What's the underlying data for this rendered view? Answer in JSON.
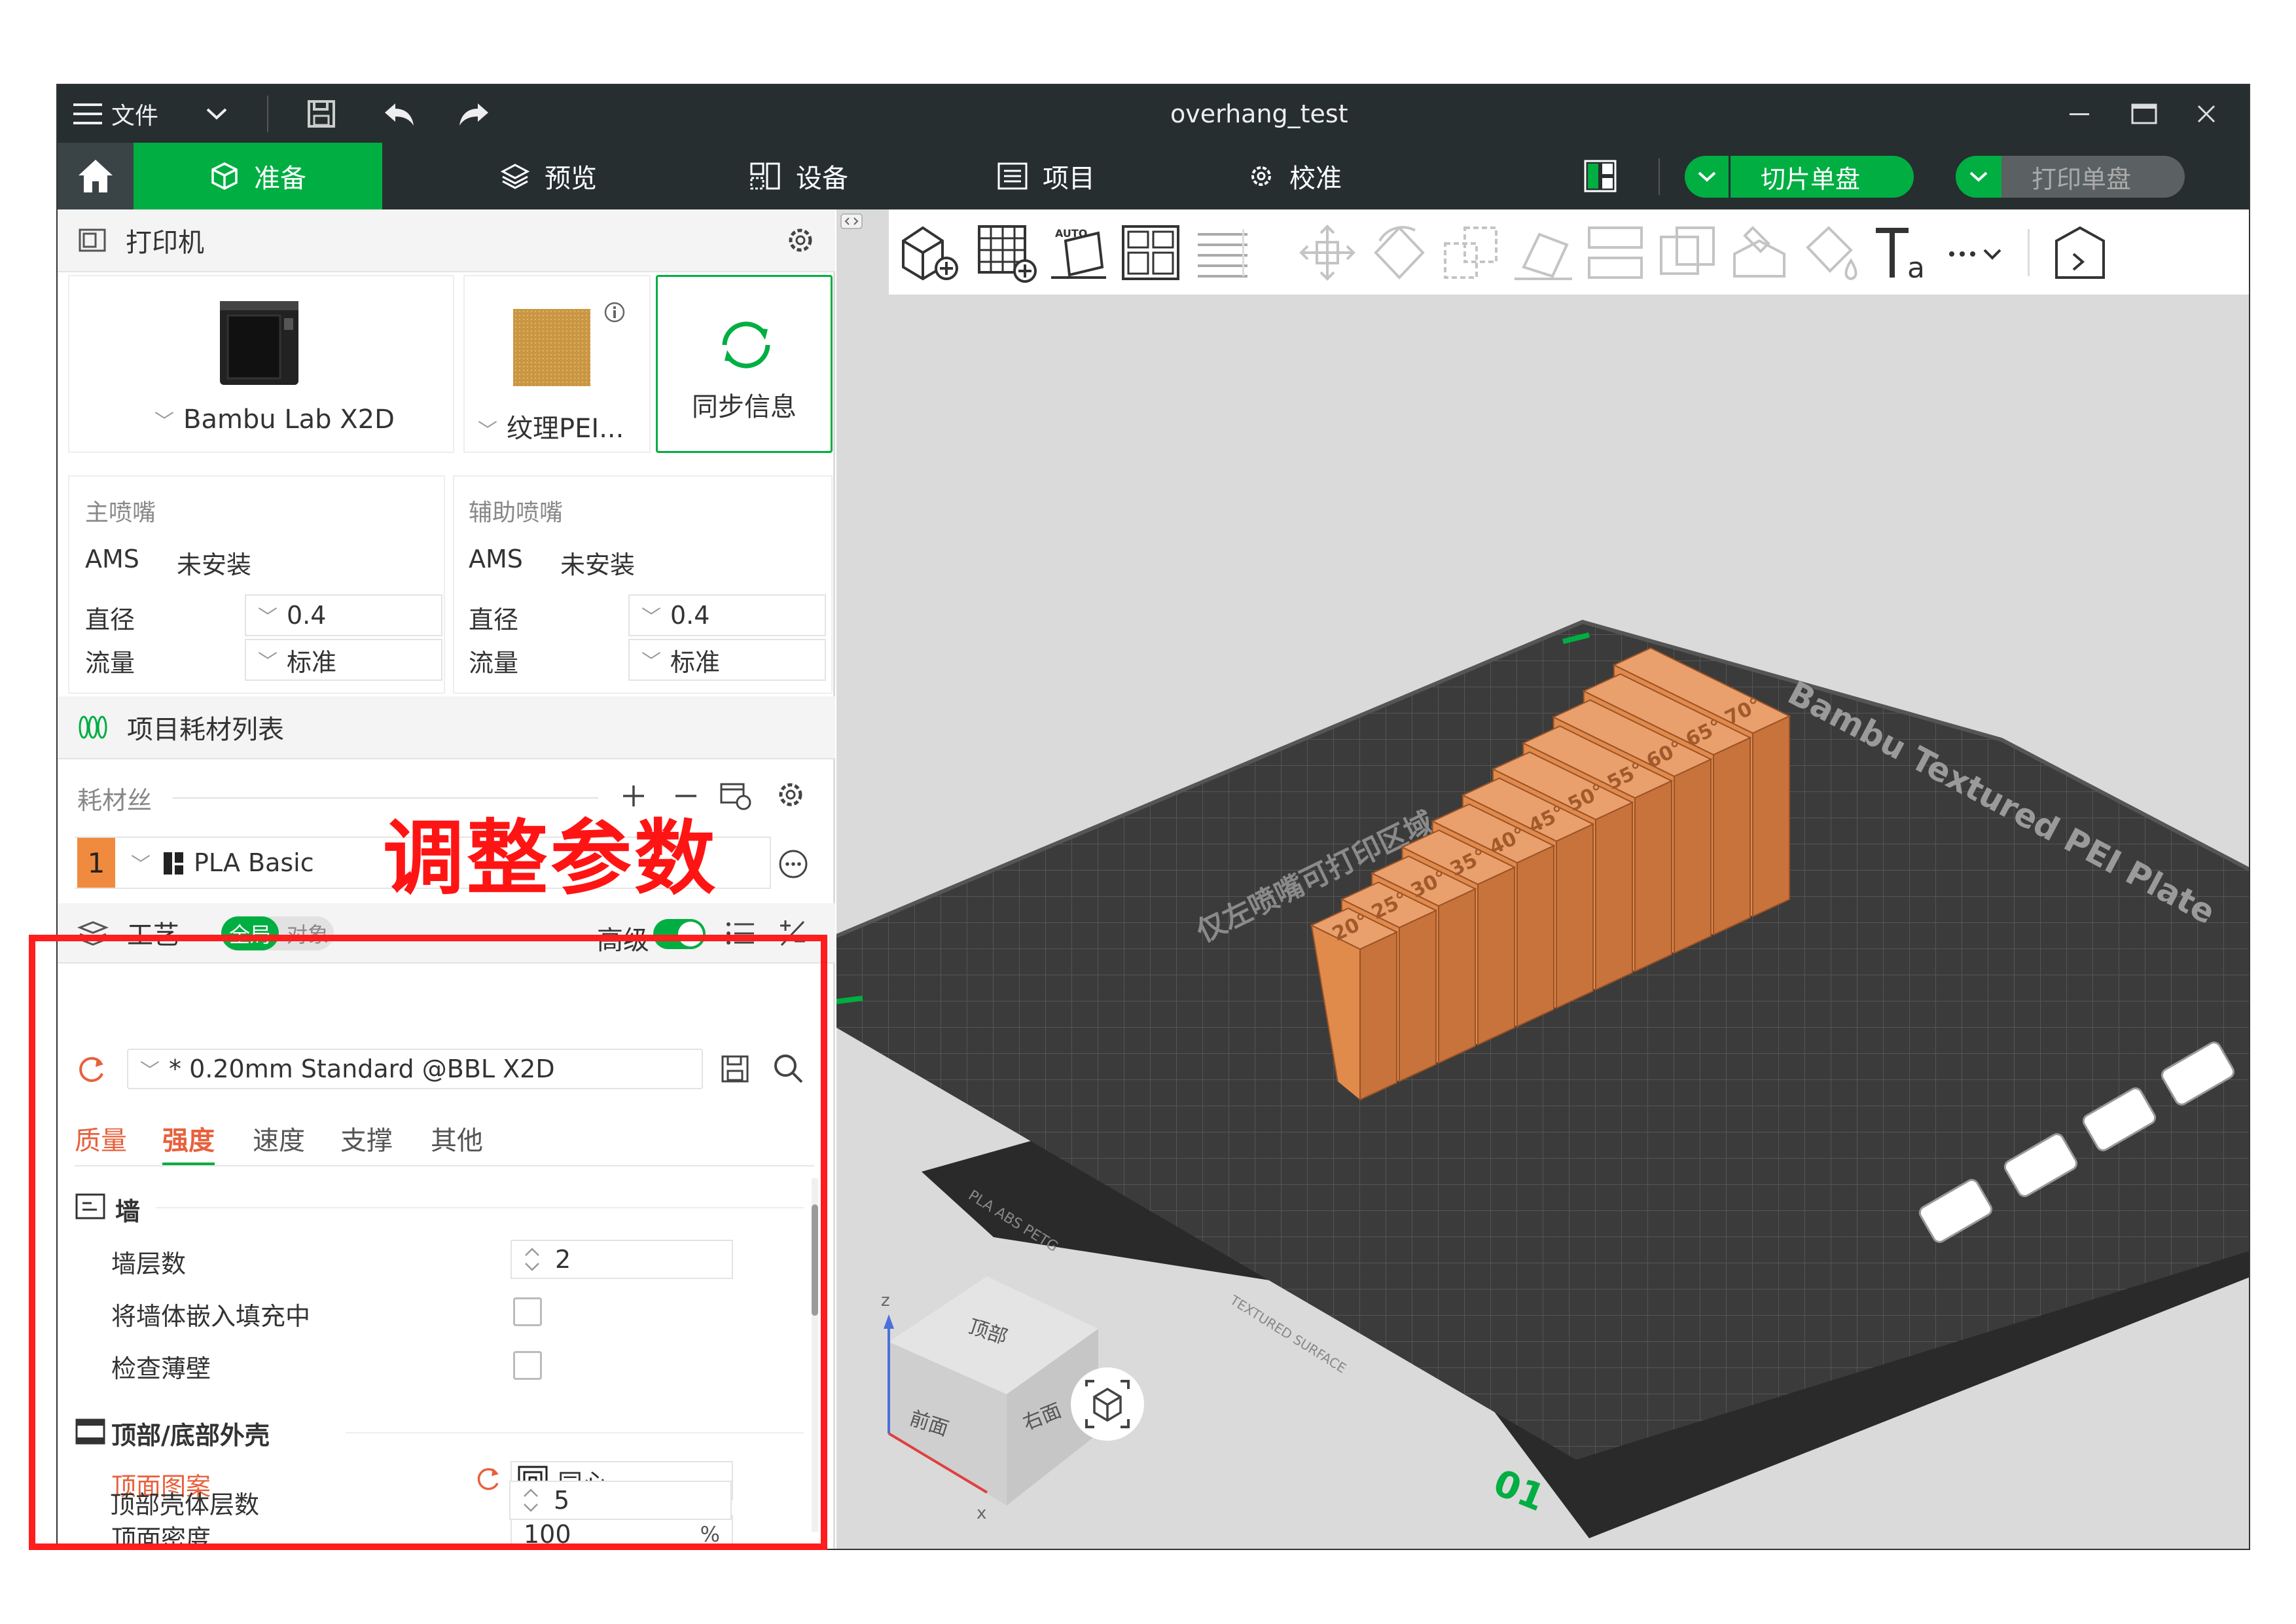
{
  "window": {
    "file_menu": "文件",
    "title": "overhang_test"
  },
  "tabs": [
    {
      "label": "准备"
    },
    {
      "label": "预览"
    },
    {
      "label": "设备"
    },
    {
      "label": "项目"
    },
    {
      "label": "校准"
    }
  ],
  "actions": {
    "slice_plate": "切片单盘",
    "print_plate": "打印单盘"
  },
  "printer": {
    "header": "打印机",
    "model": "Bambu Lab X2D",
    "plate": "纹理PEI...",
    "sync": "同步信息"
  },
  "nozzles": [
    {
      "title": "主喷嘴",
      "ams_label": "AMS",
      "ams_value": "未安装",
      "diameter_label": "直径",
      "diameter": "0.4",
      "flow_label": "流量",
      "flow": "标准"
    },
    {
      "title": "辅助喷嘴",
      "ams_label": "AMS",
      "ams_value": "未安装",
      "diameter_label": "直径",
      "diameter": "0.4",
      "flow_label": "流量",
      "flow": "标准"
    }
  ],
  "filament": {
    "header": "项目耗材列表",
    "label": "耗材丝",
    "slot": "1",
    "name": "PLA Basic",
    "slot_color": "#f08a3e"
  },
  "process": {
    "header": "工艺",
    "global": "全局",
    "object": "对象",
    "advanced": "高级",
    "preset": "* 0.20mm Standard @BBL X2D",
    "subtabs": [
      "质量",
      "强度",
      "速度",
      "支撑",
      "其他"
    ],
    "active_subtab": 1
  },
  "settings": {
    "wall_section": "墙",
    "wall_loops_label": "墙层数",
    "wall_loops": "2",
    "embed_wall_label": "将墙体嵌入填充中",
    "detect_thin_label": "检查薄壁",
    "shell_section": "顶部/底部外壳",
    "top_pattern_label": "顶面图案",
    "top_pattern": "同心",
    "top_density_label": "顶面密度",
    "top_density": "100",
    "percent": "%",
    "top_layers_label": "顶部壳体层数",
    "top_layers": "5"
  },
  "viewport": {
    "plate_note": "仅左喷嘴可打印区域",
    "plate_name": "Bambu Textured PEI Plate",
    "plate_number": "01",
    "plate_edge_left": "PLA ABS PETG",
    "plate_edge_left2": "TEXTURED SURFACE",
    "angle_labels": [
      "20°",
      "25°",
      "30°",
      "35°",
      "40°",
      "45°",
      "50°",
      "55°",
      "60°",
      "65°",
      "70°"
    ],
    "cube_top": "顶部",
    "cube_front": "前面",
    "cube_right": "右面",
    "axis_z": "z",
    "axis_x": "x",
    "model_color": "#e08a4c",
    "bed_color": "#3b3b3b"
  },
  "annotation": "调整参数",
  "colors": {
    "accent": "#00ae42",
    "active_orange": "#e8603c",
    "dark_bar": "#262e30",
    "annot_red": "#ff1414"
  }
}
